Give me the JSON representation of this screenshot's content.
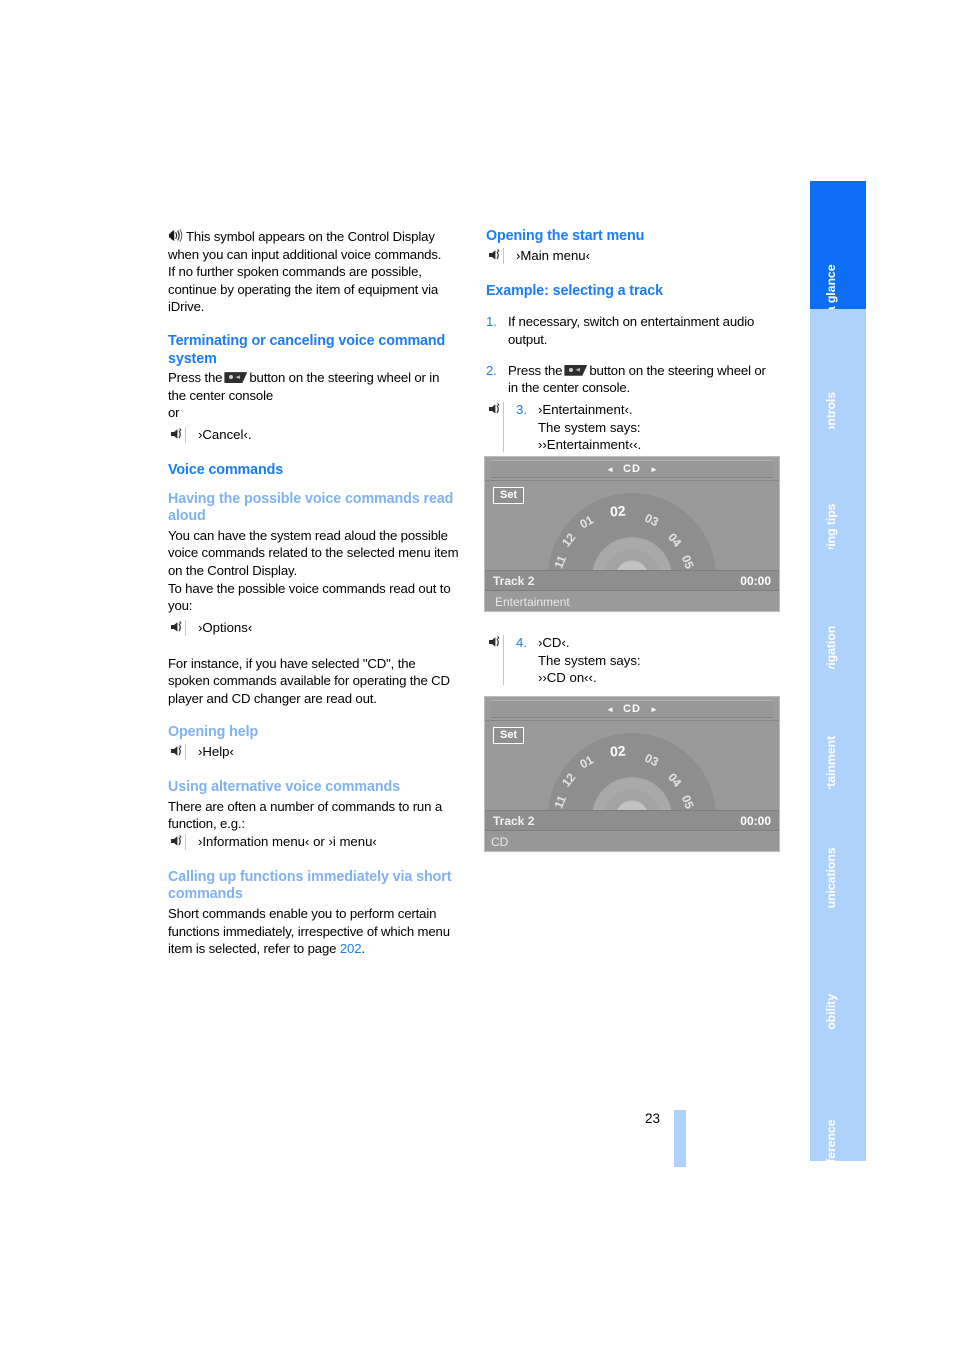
{
  "page": {
    "number": "23",
    "headings_color": "#1a7df5",
    "subheadings_color": "#7fb2ef",
    "tab_active_color": "#0b6ef5",
    "tab_inactive_color": "#aed2fb"
  },
  "left_column": {
    "intro": {
      "symbol_icon": "speech-symbol-icon",
      "text": "This symbol appears on the Control Display when you can input additional voice commands.",
      "text2": "If no further spoken commands are possible, continue by operating the item of equipment via iDrive."
    },
    "section_terminating": {
      "heading": "Terminating or canceling voice command system",
      "press_pre": "Press the",
      "press_post": "button on the steering wheel or in the center console",
      "or": "or",
      "command": "›Cancel‹."
    },
    "section_voice_commands": {
      "heading": "Voice commands"
    },
    "section_read_aloud": {
      "subheading": "Having the possible voice commands read aloud",
      "text": "You can have the system read aloud the possible voice commands related to the selected menu item on the Control Display.",
      "text2": "To have the possible voice commands read out to you:",
      "command": "›Options‹",
      "text3": "For instance, if you have selected \"CD\", the spoken commands available for operating the CD player and CD changer are read out."
    },
    "section_opening_help": {
      "subheading": "Opening help",
      "command": "›Help‹"
    },
    "section_alternative": {
      "subheading": "Using alternative voice commands",
      "text": "There are often a number of commands to run a function, e.g.:",
      "command": "›Information menu‹ or ›i menu‹"
    },
    "section_short_commands": {
      "subheading": "Calling up functions immediately via short commands",
      "text_pre": "Short commands enable you to perform certain functions immediately, irrespective of which menu item is selected, refer to page ",
      "page_ref": "202",
      "text_post": "."
    }
  },
  "right_column": {
    "section_start_menu": {
      "heading": "Opening the start menu",
      "command": "›Main menu‹"
    },
    "section_example": {
      "heading": "Example: selecting a track",
      "steps": [
        {
          "num": "1.",
          "text": "If necessary, switch on entertainment audio output."
        },
        {
          "num": "2.",
          "text_pre": "Press the",
          "text_post": "button on the steering wheel or in the center console."
        },
        {
          "num": "3.",
          "line1": "›Entertainment‹.",
          "line2": "The system says:",
          "line3": "››Entertainment‹‹."
        },
        {
          "num": "4.",
          "line1": "›CD‹.",
          "line2": "The system says:",
          "line3": "››CD on‹‹."
        }
      ]
    }
  },
  "control_display_1": {
    "top_label": "CD",
    "arrow_left": "◄",
    "arrow_right": "►",
    "set_button": "Set",
    "dial_numbers": [
      "11",
      "12",
      "01",
      "02",
      "03",
      "04",
      "05"
    ],
    "selected_number": "02",
    "track_label": "Track 2",
    "time": "00:00",
    "footer": "Entertainment"
  },
  "control_display_2": {
    "top_label": "CD",
    "arrow_left": "◄",
    "arrow_right": "►",
    "set_button": "Set",
    "dial_numbers": [
      "11",
      "12",
      "01",
      "02",
      "03",
      "04",
      "05"
    ],
    "selected_number": "02",
    "track_label": "Track 2",
    "time": "00:00",
    "footer": "CD"
  },
  "tabs": [
    {
      "label": "At a glance",
      "active": true
    },
    {
      "label": "Controls",
      "active": false
    },
    {
      "label": "Driving tips",
      "active": false
    },
    {
      "label": "Navigation",
      "active": false
    },
    {
      "label": "Entertainment",
      "active": false
    },
    {
      "label": "Communications",
      "active": false
    },
    {
      "label": "Mobility",
      "active": false
    },
    {
      "label": "Reference",
      "active": false
    }
  ]
}
